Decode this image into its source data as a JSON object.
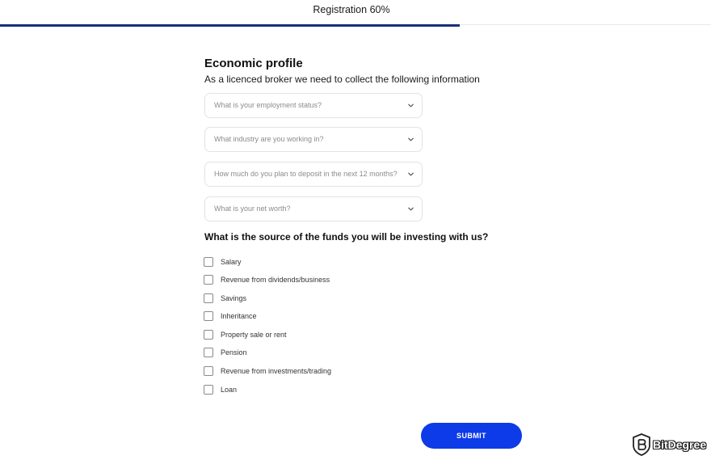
{
  "header": {
    "title": "Registration",
    "progress_label": "60%",
    "progress_fraction": 0.6
  },
  "profile": {
    "title": "Economic profile",
    "subtitle": "As a licenced broker we need to collect the following information"
  },
  "selects": [
    {
      "placeholder": "What is your employment status?"
    },
    {
      "placeholder": "What industry are you working in?"
    },
    {
      "placeholder": "How much do you plan to deposit in the next 12 months?"
    },
    {
      "placeholder": "What is your net worth?"
    }
  ],
  "funds": {
    "question": "What is the source of the funds you will be investing with us?",
    "options": [
      {
        "label": "Salary",
        "checked": false
      },
      {
        "label": "Revenue from dividends/business",
        "checked": false
      },
      {
        "label": "Savings",
        "checked": false
      },
      {
        "label": "Inheritance",
        "checked": false
      },
      {
        "label": "Property sale or rent",
        "checked": false
      },
      {
        "label": "Pension",
        "checked": false
      },
      {
        "label": "Revenue from investments/trading",
        "checked": false
      },
      {
        "label": "Loan",
        "checked": false
      }
    ]
  },
  "submit": {
    "label": "SUBMIT"
  },
  "watermark": {
    "text": "BitDegree"
  },
  "colors": {
    "progress": "#17307a",
    "submit": "#0d3be8",
    "border": "#e3e3e3"
  },
  "icons": {
    "select_arrow": "chevron-down-icon",
    "watermark_logo": "bitdegree-logo-icon"
  }
}
